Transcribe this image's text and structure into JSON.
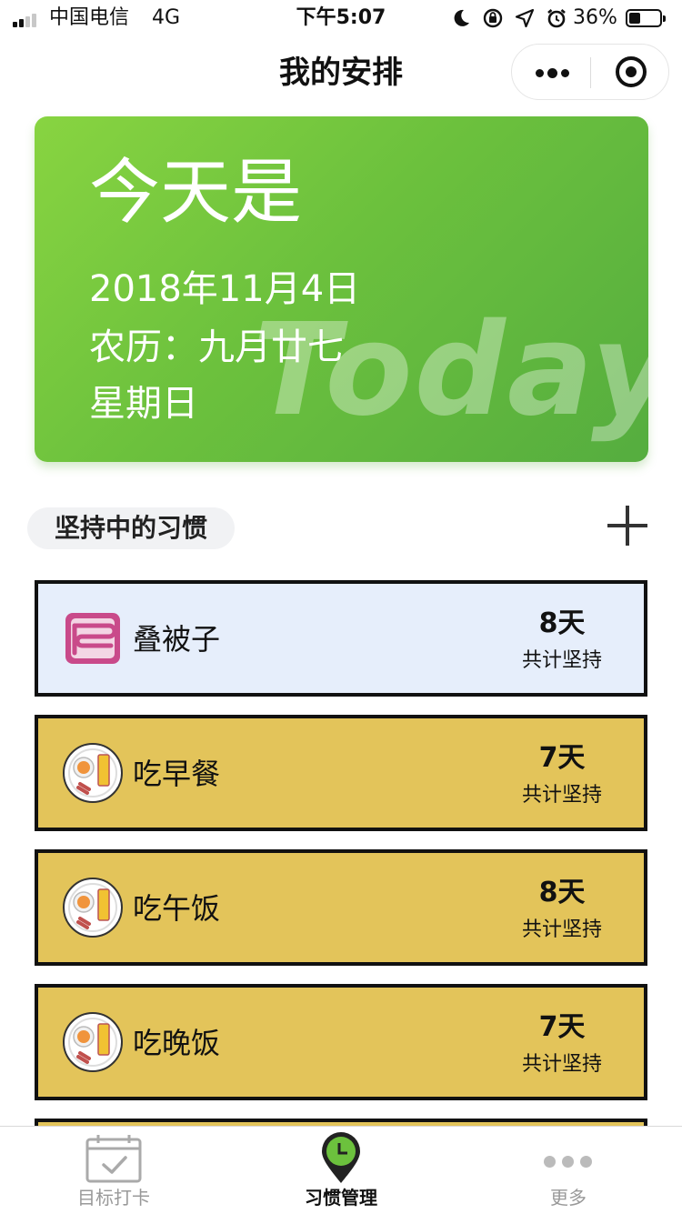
{
  "status_bar": {
    "carrier": "中国电信",
    "network": "4G",
    "time": "下午5:07",
    "battery_percent": "36%",
    "battery_level": 0.36
  },
  "nav": {
    "title": "我的安排"
  },
  "today_card": {
    "heading": "今天是",
    "date": "2018年11月4日",
    "lunar": "农历：九月廿七",
    "weekday": "星期日",
    "watermark": "Today"
  },
  "section": {
    "title": "坚持中的习惯"
  },
  "habits": [
    {
      "name": "叠被子",
      "days": "8天",
      "caption": "共计坚持",
      "color": "#e6eefb",
      "icon": "quilt-icon"
    },
    {
      "name": "吃早餐",
      "days": "7天",
      "caption": "共计坚持",
      "color": "#e3c45a",
      "icon": "plate-icon"
    },
    {
      "name": "吃午饭",
      "days": "8天",
      "caption": "共计坚持",
      "color": "#e3c45a",
      "icon": "plate-icon"
    },
    {
      "name": "吃晚饭",
      "days": "7天",
      "caption": "共计坚持",
      "color": "#e3c45a",
      "icon": "plate-icon"
    }
  ],
  "tab_bar": {
    "tabs": [
      {
        "label": "目标打卡",
        "icon": "calendar-check-icon",
        "active": false
      },
      {
        "label": "习惯管理",
        "icon": "location-clock-icon",
        "active": true
      },
      {
        "label": "更多",
        "icon": "more-dots-icon",
        "active": false
      }
    ]
  },
  "colors": {
    "card_green": "#6cc13d",
    "habit_yellow": "#e3c45a",
    "habit_blue": "#e6eefb",
    "active_tab_green": "#6cc13d"
  }
}
